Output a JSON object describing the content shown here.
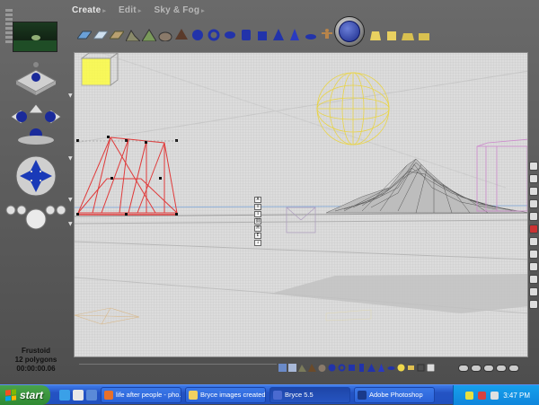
{
  "menu": {
    "create": "Create",
    "edit": "Edit",
    "sky_fog": "Sky & Fog"
  },
  "object_info": {
    "name": "Frustoid",
    "polygons": "12 polygons",
    "time": "00:00:00.06"
  },
  "mini_tools": [
    "A",
    "≡",
    "↕",
    "⛓",
    "M",
    "E",
    "↓"
  ],
  "taskbar": {
    "start": "start",
    "tasks": [
      {
        "label": "life after people - pho...",
        "icon": "firefox-icon",
        "active": false
      },
      {
        "label": "Bryce images created...",
        "icon": "folder-icon",
        "active": false
      },
      {
        "label": "Bryce 5.5",
        "icon": "bryce-icon",
        "active": true
      },
      {
        "label": "Adobe Photoshop",
        "icon": "photoshop-icon",
        "active": false
      }
    ],
    "clock": "3:47 PM"
  },
  "colors": {
    "selection_red": "#e03a3a",
    "wire_yellow": "#e8d44a",
    "wire_gray": "#555555",
    "wire_pink": "#cc88cc",
    "accent_blue": "#1a2a8a"
  }
}
